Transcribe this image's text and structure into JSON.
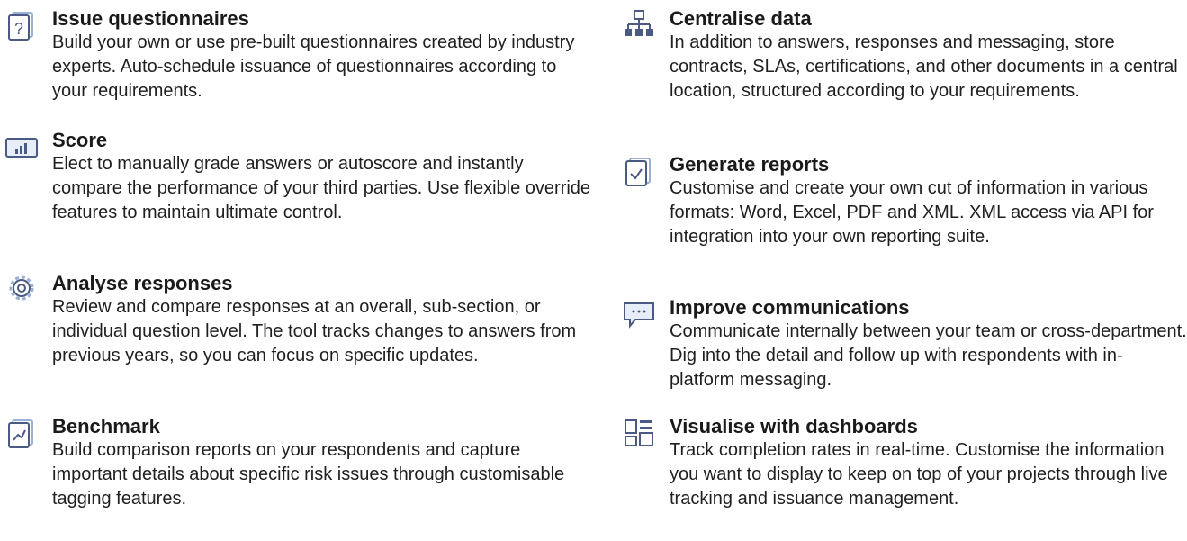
{
  "features_left": [
    {
      "title": "Issue questionnaires",
      "text": "Build your own or use pre-built questionnaires created by industry experts. Auto-schedule issuance of questionnaires according to your requirements.",
      "icon": "questionnaire-icon"
    },
    {
      "title": "Score",
      "text": "Elect to manually grade answers or autoscore and instantly compare the performance of your third parties. Use flexible override features to maintain ultimate control.",
      "icon": "bar-chart-icon"
    },
    {
      "title": "Analyse responses",
      "text": "Review and compare responses at an overall, sub-section, or individual question level. The tool tracks changes to answers from previous years, so you can focus on specific updates.",
      "icon": "gear-icon"
    },
    {
      "title": "Benchmark",
      "text": "Build comparison reports on your respondents and capture important details about specific risk issues through customisable tagging features.",
      "icon": "trend-document-icon"
    }
  ],
  "features_right": [
    {
      "title": "Centralise data",
      "text": "In addition to answers, responses and messaging, store contracts, SLAs, certifications, and other documents in a central location, structured according to your requirements.",
      "icon": "hierarchy-icon"
    },
    {
      "title": "Generate reports",
      "text": "Customise and create your own cut of information in various formats: Word, Excel, PDF and XML. XML access via API for integration into your own reporting suite.",
      "icon": "report-check-icon"
    },
    {
      "title": "Improve communications",
      "text": "Communicate internally between your team or cross-department. Dig into the detail and follow up with respondents with in-platform messaging.",
      "icon": "chat-bubble-icon"
    },
    {
      "title": "Visualise with dashboards",
      "text": "Track completion rates in real-time. Customise the information you want to display to keep on top of your projects through live tracking and issuance management.",
      "icon": "dashboard-icon"
    }
  ],
  "colors": {
    "icon_blue": "#4a5a82",
    "icon_light": "#9bb0d6",
    "text": "#1a1a1a"
  }
}
